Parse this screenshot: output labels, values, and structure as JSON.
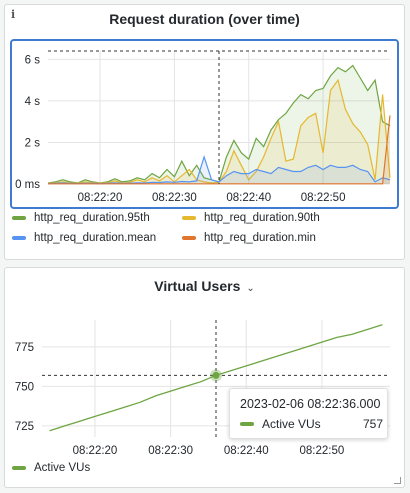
{
  "panel1": {
    "info_icon": "i",
    "title": "Request duration (over time)",
    "legend": [
      {
        "name": "http_req_duration.95th",
        "color": "#6ea542"
      },
      {
        "name": "http_req_duration.90th",
        "color": "#e5b82e"
      },
      {
        "name": "http_req_duration.mean",
        "color": "#5794f2"
      },
      {
        "name": "http_req_duration.min",
        "color": "#e0752d"
      }
    ]
  },
  "panel2": {
    "title": "Virtual Users",
    "legend": [
      {
        "name": "Active VUs",
        "color": "#6ea542"
      }
    ],
    "tooltip": {
      "time": "2023-02-06 08:22:36.000",
      "series": "Active VUs",
      "value": "757"
    }
  },
  "chart_data": [
    {
      "type": "area",
      "title": "Request duration (over time)",
      "x_ticks": [
        "08:22:20",
        "08:22:30",
        "08:22:40",
        "08:22:50"
      ],
      "y_ticks": [
        "0 ms",
        "2 s",
        "4 s",
        "6 s"
      ],
      "y_tick_values": [
        0,
        2,
        4,
        6
      ],
      "y_unit": "s",
      "ylim": [
        0,
        6.4
      ],
      "xlim": [
        13,
        59
      ],
      "hover_x": 36,
      "hover_y": 6.4,
      "series": [
        {
          "name": "http_req_duration.95th",
          "color": "#6ea542",
          "x": [
            13,
            14,
            15,
            16,
            17,
            18,
            19,
            20,
            21,
            22,
            23,
            24,
            25,
            26,
            27,
            28,
            29,
            30,
            31,
            32,
            33,
            34,
            35,
            36,
            37,
            38,
            39,
            40,
            41,
            42,
            43,
            44,
            45,
            46,
            47,
            48,
            49,
            50,
            51,
            52,
            53,
            54,
            55,
            56,
            57,
            58,
            59
          ],
          "y": [
            0.05,
            0.1,
            0.2,
            0.1,
            0.05,
            0.2,
            0.1,
            0.05,
            0.1,
            0.25,
            0.1,
            0.15,
            0.3,
            0.2,
            0.5,
            0.3,
            0.7,
            0.35,
            1.1,
            0.4,
            0.9,
            0.3,
            0.2,
            0.1,
            1.3,
            2.1,
            1.5,
            1.2,
            2.2,
            1.8,
            2.6,
            3.1,
            3.4,
            3.9,
            4.3,
            4.1,
            4.5,
            4.6,
            5.2,
            5.6,
            5.4,
            5.7,
            5.1,
            4.5,
            5.0,
            3.0,
            2.8
          ]
        },
        {
          "name": "http_req_duration.90th",
          "color": "#e5b82e",
          "x": [
            13,
            14,
            15,
            16,
            17,
            18,
            19,
            20,
            21,
            22,
            23,
            24,
            25,
            26,
            27,
            28,
            29,
            30,
            31,
            32,
            33,
            34,
            35,
            36,
            37,
            38,
            39,
            40,
            41,
            42,
            43,
            44,
            45,
            46,
            47,
            48,
            49,
            50,
            51,
            52,
            53,
            54,
            55,
            56,
            57,
            58,
            59
          ],
          "y": [
            0.04,
            0.05,
            0.1,
            0.05,
            0.03,
            0.1,
            0.06,
            0.04,
            0.06,
            0.15,
            0.05,
            0.08,
            0.2,
            0.1,
            0.3,
            0.15,
            0.4,
            0.1,
            0.4,
            0.7,
            0.2,
            0.1,
            0.05,
            0.08,
            0.6,
            1.6,
            0.9,
            0.2,
            0.6,
            1.3,
            2.2,
            3.0,
            1.1,
            1.2,
            2.8,
            3.2,
            3.4,
            1.5,
            4.5,
            5.0,
            3.6,
            2.9,
            2.5,
            1.9,
            0.2,
            4.3,
            0.3
          ]
        },
        {
          "name": "http_req_duration.mean",
          "color": "#5794f2",
          "x": [
            13,
            14,
            15,
            16,
            17,
            18,
            19,
            20,
            21,
            22,
            23,
            24,
            25,
            26,
            27,
            28,
            29,
            30,
            31,
            32,
            33,
            34,
            35,
            36,
            37,
            38,
            39,
            40,
            41,
            42,
            43,
            44,
            45,
            46,
            47,
            48,
            49,
            50,
            51,
            52,
            53,
            54,
            55,
            56,
            57,
            58,
            59
          ],
          "y": [
            0.02,
            0.03,
            0.05,
            0.03,
            0.02,
            0.04,
            0.03,
            0.02,
            0.03,
            0.06,
            0.03,
            0.04,
            0.06,
            0.05,
            0.08,
            0.07,
            0.1,
            0.08,
            0.12,
            0.1,
            0.15,
            1.3,
            0.2,
            0.1,
            0.4,
            0.6,
            0.5,
            0.5,
            0.7,
            0.6,
            0.5,
            0.8,
            0.7,
            0.6,
            0.6,
            0.8,
            0.9,
            0.7,
            0.9,
            0.8,
            0.8,
            0.9,
            0.7,
            0.6,
            0.1,
            0.3,
            0.2
          ]
        },
        {
          "name": "http_req_duration.min",
          "color": "#e0752d",
          "x": [
            13,
            14,
            15,
            16,
            17,
            18,
            19,
            20,
            21,
            22,
            23,
            24,
            25,
            26,
            27,
            28,
            29,
            30,
            31,
            32,
            33,
            34,
            35,
            36,
            37,
            38,
            39,
            40,
            41,
            42,
            43,
            44,
            45,
            46,
            47,
            48,
            49,
            50,
            51,
            52,
            53,
            54,
            55,
            56,
            57,
            58,
            59
          ],
          "y": [
            0.01,
            0.01,
            0.01,
            0.01,
            0.01,
            0.01,
            0.01,
            0.01,
            0.01,
            0.01,
            0.01,
            0.01,
            0.01,
            0.01,
            0.01,
            0.01,
            0.01,
            0.01,
            0.01,
            0.01,
            0.01,
            0.01,
            0.01,
            0.01,
            0.01,
            0.01,
            0.01,
            0.01,
            0.01,
            0.01,
            0.01,
            0.01,
            0.01,
            0.01,
            0.01,
            0.01,
            0.01,
            0.01,
            0.01,
            0.01,
            0.01,
            0.01,
            0.01,
            0.01,
            0.01,
            0.01,
            3.3
          ]
        }
      ]
    },
    {
      "type": "line",
      "title": "Virtual Users",
      "x_ticks": [
        "08:22:20",
        "08:22:30",
        "08:22:40",
        "08:22:50"
      ],
      "y_ticks": [
        "725",
        "750",
        "775"
      ],
      "y_tick_values": [
        725,
        750,
        775
      ],
      "ylim": [
        718,
        792
      ],
      "xlim": [
        13,
        59
      ],
      "hover": {
        "x": 36,
        "y": 757
      },
      "series": [
        {
          "name": "Active VUs",
          "color": "#6ea542",
          "x": [
            14,
            16,
            18,
            20,
            22,
            24,
            26,
            28,
            30,
            32,
            34,
            36,
            38,
            40,
            42,
            44,
            46,
            48,
            50,
            52,
            54,
            56,
            58
          ],
          "y": [
            722,
            725,
            728,
            731,
            734,
            737,
            740,
            744,
            747,
            750,
            753,
            757,
            760,
            763,
            766,
            769,
            772,
            775,
            778,
            781,
            783,
            786,
            789
          ]
        }
      ]
    }
  ]
}
